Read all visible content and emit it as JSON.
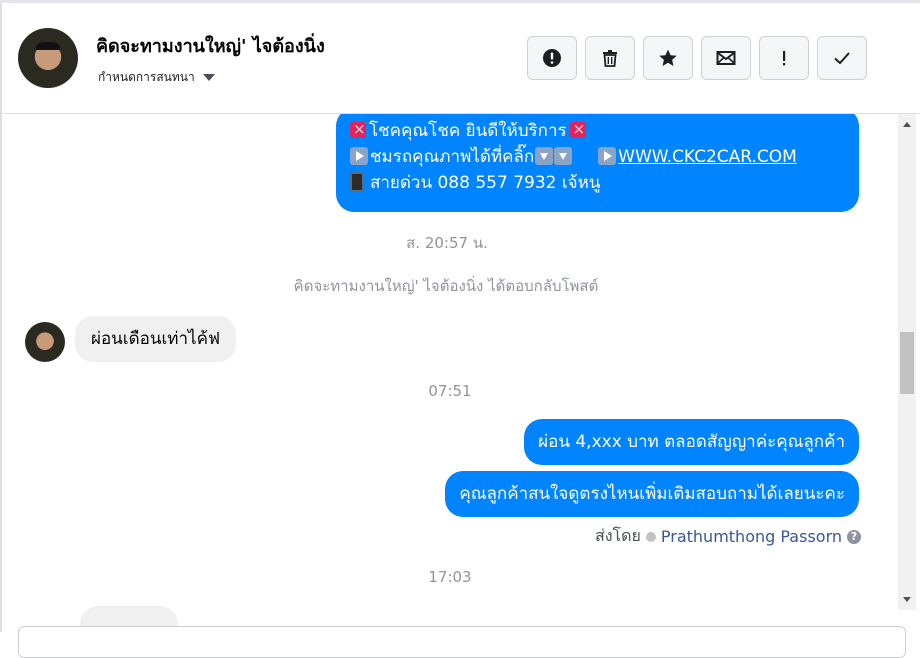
{
  "header": {
    "title": "คิดจะทามงานใหญ่' ไจต้องนิ่ง",
    "subtitle": "กำหนดการสนทนา"
  },
  "toolbar": {
    "buttons": [
      {
        "icon": "alert-circle-icon"
      },
      {
        "icon": "trash-icon"
      },
      {
        "icon": "star-icon"
      },
      {
        "icon": "envelope-icon"
      },
      {
        "icon": "exclamation-icon"
      },
      {
        "icon": "checkmark-icon"
      }
    ]
  },
  "messages": {
    "outgoing_promo": {
      "line1": "โชคคุณโชค ยินดีให้บริการ",
      "line2": "ชมรถคุณภาพได้ที่คลิ๊ก",
      "link": "WWW.CKC2CAR.COM",
      "line3": "สายด่วน 088 557 7932 เจ้หนู"
    },
    "time1": "ส. 20:57 น.",
    "meta_reply": "คิดจะทามงานใหญ่' ไจต้องนิ่ง ได้ตอบกลับโพสต์",
    "incoming1": "ผ่อนเดือนเท่าไค้ฟ",
    "time2": "07:51",
    "outgoing2": "ผ่อน 4,xxx บาท ตลอดสัญญาค่ะคุณลูกค้า",
    "outgoing3": "คุณลูกค้าสนใจดูตรงไหนเพิ่มเติมสอบถามได้เลยนะคะ",
    "sent_by_label": "ส่งโดย",
    "sent_by_name": "Prathumthong Passorn",
    "time3": "17:03"
  },
  "colors": {
    "outgoing_bubble": "#0084ff",
    "incoming_bubble": "#f1f0f0",
    "meta_text": "#90949c"
  }
}
